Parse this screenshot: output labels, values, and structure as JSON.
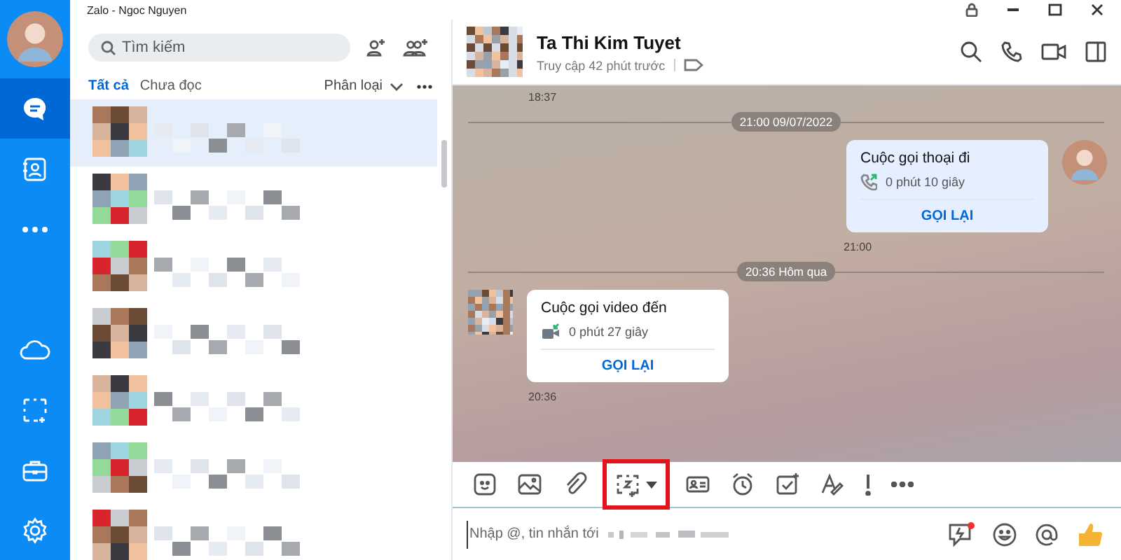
{
  "window": {
    "title": "Zalo - Ngoc Nguyen"
  },
  "nav": [
    {
      "kind": "avatar",
      "selected": false
    },
    {
      "kind": "chat",
      "selected": true
    },
    {
      "kind": "contacts",
      "selected": false
    },
    {
      "kind": "more",
      "selected": false
    },
    {
      "kind": "cloud",
      "selected": false
    },
    {
      "kind": "capture",
      "selected": false
    },
    {
      "kind": "toolbox",
      "selected": false
    },
    {
      "kind": "settings",
      "selected": false
    }
  ],
  "search": {
    "placeholder": "Tìm kiếm"
  },
  "filter_tabs": [
    {
      "label": "Tất cả",
      "selected": true
    },
    {
      "label": "Chưa đọc",
      "selected": false
    }
  ],
  "sort": {
    "label": "Phân loại"
  },
  "conversations": [
    {
      "kind": "redacted",
      "selected": true
    },
    {
      "kind": "redacted",
      "selected": false
    },
    {
      "kind": "redacted",
      "selected": false
    },
    {
      "kind": "redacted",
      "selected": false
    },
    {
      "kind": "redacted",
      "selected": false
    },
    {
      "kind": "redacted",
      "selected": false
    },
    {
      "kind": "redacted",
      "selected": false
    }
  ],
  "chat": {
    "name": "Ta Thi Kim Tuyet",
    "status": "Truy cập 42 phút trước"
  },
  "messages": [
    {
      "kind": "time",
      "text": "18:37"
    },
    {
      "kind": "divider",
      "text": "21:00 09/07/2022"
    },
    {
      "kind": "call",
      "outgoing": true,
      "video": false,
      "title": "Cuộc gọi thoại đi",
      "duration": "0 phút 10 giây",
      "action": "GỌI LẠI",
      "time": "21:00"
    },
    {
      "kind": "divider",
      "text": "20:36 Hôm qua"
    },
    {
      "kind": "call",
      "outgoing": false,
      "video": true,
      "title": "Cuộc gọi video đến",
      "duration": "0 phút 27 giây",
      "action": "GỌI LẠI",
      "time": "20:36"
    }
  ],
  "toolbar": [
    {
      "highlighted": false
    },
    {
      "highlighted": false
    },
    {
      "highlighted": false
    },
    {
      "highlighted": true
    },
    {
      "highlighted": false
    },
    {
      "highlighted": false
    },
    {
      "highlighted": false
    },
    {
      "highlighted": false
    },
    {
      "highlighted": false
    },
    {
      "highlighted": false
    }
  ],
  "composer": {
    "placeholder": "Nhập @, tin nhắn tới"
  }
}
